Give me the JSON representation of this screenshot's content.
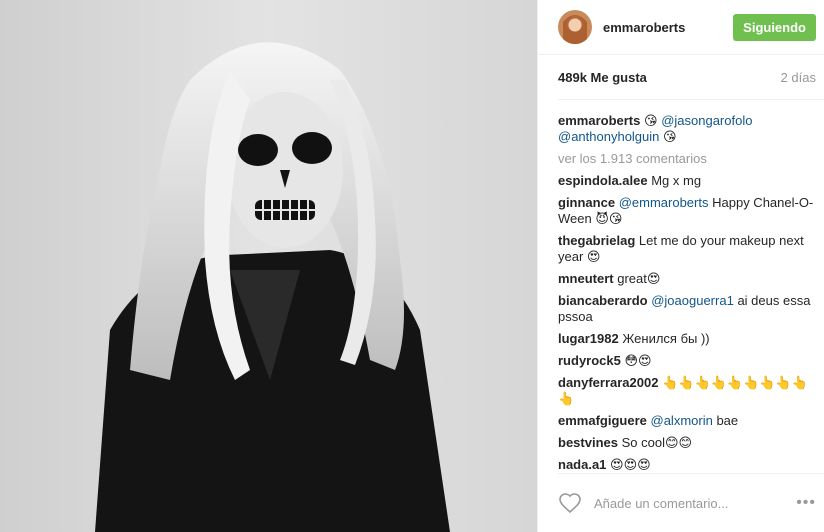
{
  "post": {
    "username": "emmaroberts",
    "follow_label": "Siguiendo",
    "likes": "489k Me gusta",
    "time": "2 días",
    "caption": {
      "user": "emmaroberts",
      "emoji1": "😘",
      "mention1": "@jasongarofolo",
      "mention2": "@anthonyholguin",
      "emoji2": "😘"
    },
    "view_all": "ver los 1.913 comentarios",
    "comments": [
      {
        "user": "espindola.alee",
        "text": "Mg x mg"
      },
      {
        "user": "ginnance",
        "mention": "@emmaroberts",
        "text": "Happy Chanel-O-Ween 😈😘"
      },
      {
        "user": "thegabrielag",
        "text": "Let me do your makeup next year 😍"
      },
      {
        "user": "mneutert",
        "text": "great😍"
      },
      {
        "user": "biancaberardo",
        "mention": "@joaoguerra1",
        "text": "ai deus essa pssoa"
      },
      {
        "user": "lugar1982",
        "text": "Женился бы ))"
      },
      {
        "user": "rudyrock5",
        "text": "😳😍"
      },
      {
        "user": "danyferrara2002",
        "text": "👆👆👆👆👆👆👆👆👆👆"
      },
      {
        "user": "emmafgiguere",
        "mention": "@alxmorin",
        "text": "bae"
      },
      {
        "user": "bestvines",
        "text": "So cool😊😊"
      },
      {
        "user": "nada.a1",
        "text": "😍😍😍"
      }
    ],
    "add_comment_placeholder": "Añade un comentario...",
    "more_label": "•••"
  },
  "icons": {
    "heart": "heart-outline-icon",
    "more": "more-options-icon"
  },
  "colors": {
    "follow_bg": "#70c050",
    "mention": "#125688",
    "muted": "#999999"
  }
}
